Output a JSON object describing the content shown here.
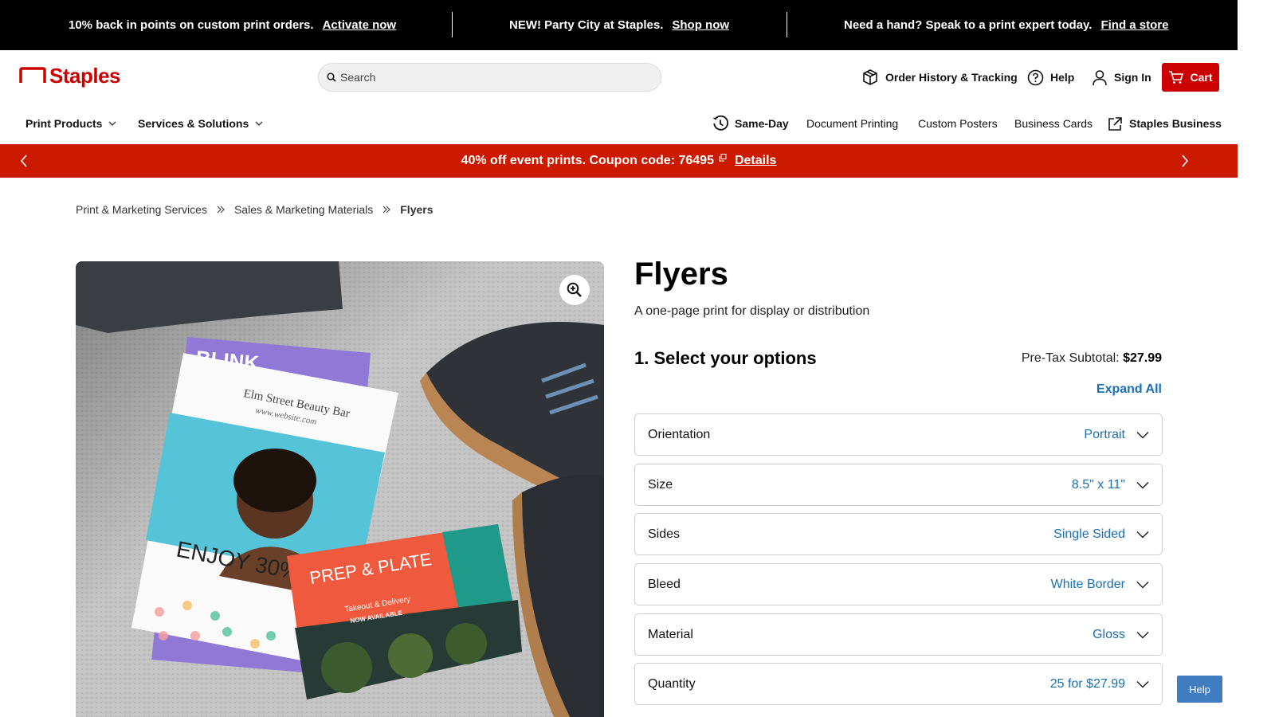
{
  "topbar": {
    "promo1_text": "10% back in points on custom print orders.",
    "promo1_link": "Activate now",
    "promo2_text": "NEW! Party City at Staples.",
    "promo2_link": "Shop now",
    "promo3_text": "Need a hand? Speak to a print expert today.",
    "promo3_link": "Find a store"
  },
  "header": {
    "logo_text": "Staples",
    "search_placeholder": "Search",
    "order_history": "Order History & Tracking",
    "help": "Help",
    "sign_in": "Sign In",
    "cart": "Cart"
  },
  "nav": {
    "print_products": "Print Products",
    "services": "Services & Solutions",
    "same_day": "Same-Day",
    "document_printing": "Document Printing",
    "custom_posters": "Custom Posters",
    "business_cards": "Business Cards",
    "staples_business": "Staples Business"
  },
  "banner": {
    "text": "40% off event prints. Coupon code: 76495",
    "details": "Details"
  },
  "breadcrumb": {
    "items": [
      "Print & Marketing Services",
      "Sales & Marketing Materials"
    ],
    "current": "Flyers"
  },
  "product": {
    "title": "Flyers",
    "subtitle": "A one-page print for display or distribution",
    "step_heading": "1. Select your options",
    "subtotal_label": "Pre-Tax Subtotal:",
    "subtotal_value": "$27.99",
    "expand_all": "Expand All",
    "image_text": {
      "brand_top": "BLINK",
      "salon_name": "Elm Street Beauty Bar",
      "salon_site": "www.website.com",
      "enjoy": "ENJOY 30%",
      "prep_plate": "PREP & PLATE",
      "takeout": "Takeout & Delivery",
      "now_available": "NOW AVAILABLE"
    },
    "options": [
      {
        "label": "Orientation",
        "value": "Portrait"
      },
      {
        "label": "Size",
        "value": "8.5\" x 11\""
      },
      {
        "label": "Sides",
        "value": "Single Sided"
      },
      {
        "label": "Bleed",
        "value": "White Border"
      },
      {
        "label": "Material",
        "value": "Gloss"
      },
      {
        "label": "Quantity",
        "value": "25 for $27.99"
      }
    ]
  },
  "help_chip": "Help",
  "colors": {
    "brand_red": "#cc0000",
    "banner_red": "#cc1a00",
    "link_blue": "#1a6fb3",
    "help_blue": "#3f7cc0"
  }
}
